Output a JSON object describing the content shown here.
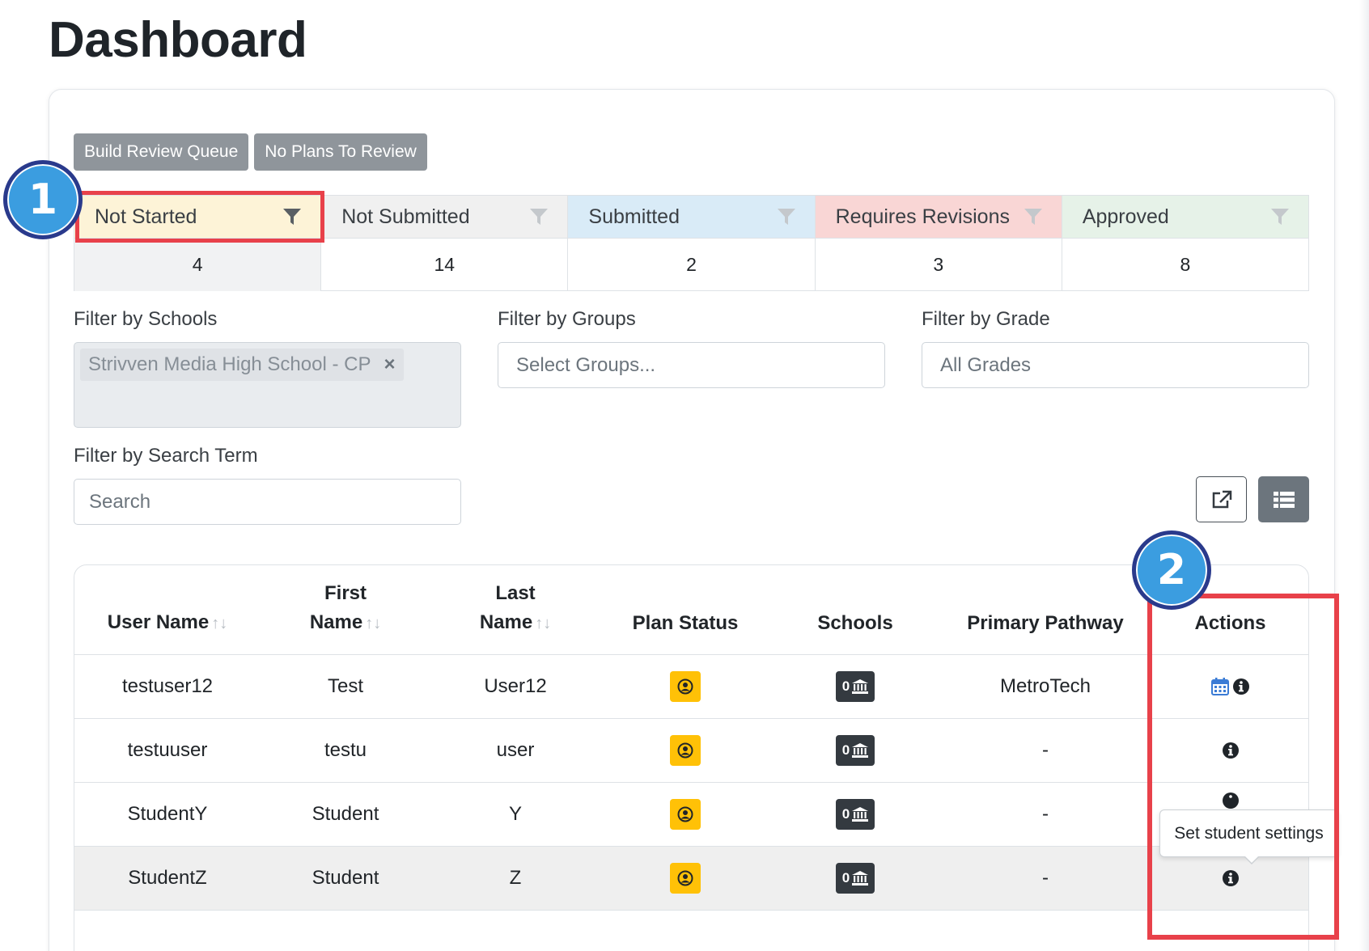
{
  "page": {
    "title": "Dashboard"
  },
  "toolbar": {
    "build_review_queue": "Build Review Queue",
    "no_plans_to_review": "No Plans To Review"
  },
  "statuses": [
    {
      "label": "Not Started",
      "count": "4"
    },
    {
      "label": "Not Submitted",
      "count": "14"
    },
    {
      "label": "Submitted",
      "count": "2"
    },
    {
      "label": "Requires Revisions",
      "count": "3"
    },
    {
      "label": "Approved",
      "count": "8"
    }
  ],
  "filters": {
    "schools": {
      "label": "Filter by Schools",
      "selected": "Strivven Media High School - CP",
      "remove": "×"
    },
    "groups": {
      "label": "Filter by Groups",
      "placeholder": "Select Groups..."
    },
    "grade": {
      "label": "Filter by Grade",
      "value": "All Grades"
    },
    "search": {
      "label": "Filter by Search Term",
      "placeholder": "Search"
    }
  },
  "annotations": {
    "badge1": "1",
    "badge2": "2"
  },
  "table": {
    "headers": {
      "username": "User Name",
      "firstname_1": "First",
      "firstname_2": "Name",
      "lastname_1": "Last",
      "lastname_2": "Name",
      "plan_status": "Plan Status",
      "schools": "Schools",
      "pathway": "Primary Pathway",
      "actions": "Actions"
    },
    "sort_glyph": "↑↓",
    "rows": [
      {
        "username": "testuser12",
        "first": "Test",
        "last": "User12",
        "schools": "0",
        "pathway": "MetroTech"
      },
      {
        "username": "testuuser",
        "first": "testu",
        "last": "user",
        "schools": "0",
        "pathway": "-"
      },
      {
        "username": "StudentY",
        "first": "Student",
        "last": "Y",
        "schools": "0",
        "pathway": "-"
      },
      {
        "username": "StudentZ",
        "first": "Student",
        "last": "Z",
        "schools": "0",
        "pathway": "-"
      }
    ]
  },
  "tooltip": {
    "text": "Set student settings"
  },
  "colors": {
    "accent_red": "#e8414a",
    "badge_blue": "#3b9de0",
    "plan_yellow": "#ffc107",
    "not_started_bg": "#fdf3d7",
    "submitted_bg": "#d9ebf7",
    "requires_bg": "#f9d6d5",
    "approved_bg": "#e6f2e8",
    "calendar_blue": "#3a7bd5"
  },
  "icons": {
    "filter": "funnel-icon",
    "external": "external-link-icon",
    "list": "list-icon",
    "plan": "user-circle-icon",
    "school": "bank-icon",
    "calendar": "calendar-icon",
    "info": "info-circle-icon"
  }
}
